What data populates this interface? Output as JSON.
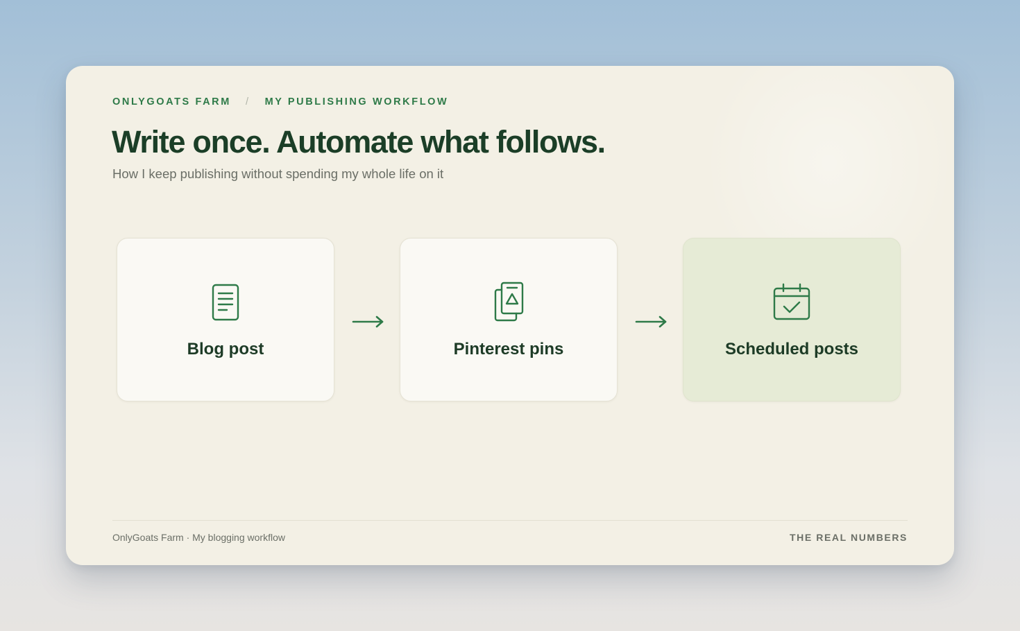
{
  "breadcrumb": {
    "brand": "ONLYGOATS FARM",
    "separator": "/",
    "section": "MY PUBLISHING WORKFLOW"
  },
  "title": "Write once. Automate what follows.",
  "subtitle": "How I keep publishing without spending my whole life on it",
  "steps": [
    {
      "label": "Blog post",
      "icon": "document-icon"
    },
    {
      "label": "Pinterest pins",
      "icon": "pins-icon"
    },
    {
      "label": "Scheduled posts",
      "icon": "calendar-check-icon"
    }
  ],
  "footer": {
    "left": "OnlyGoats Farm · My blogging workflow",
    "right": "THE REAL NUMBERS"
  },
  "colors": {
    "accent_green": "#2e7a48",
    "title_green": "#1b3e27",
    "card_background": "#f3f0e5",
    "highlight_step": "#e6ebd6"
  }
}
